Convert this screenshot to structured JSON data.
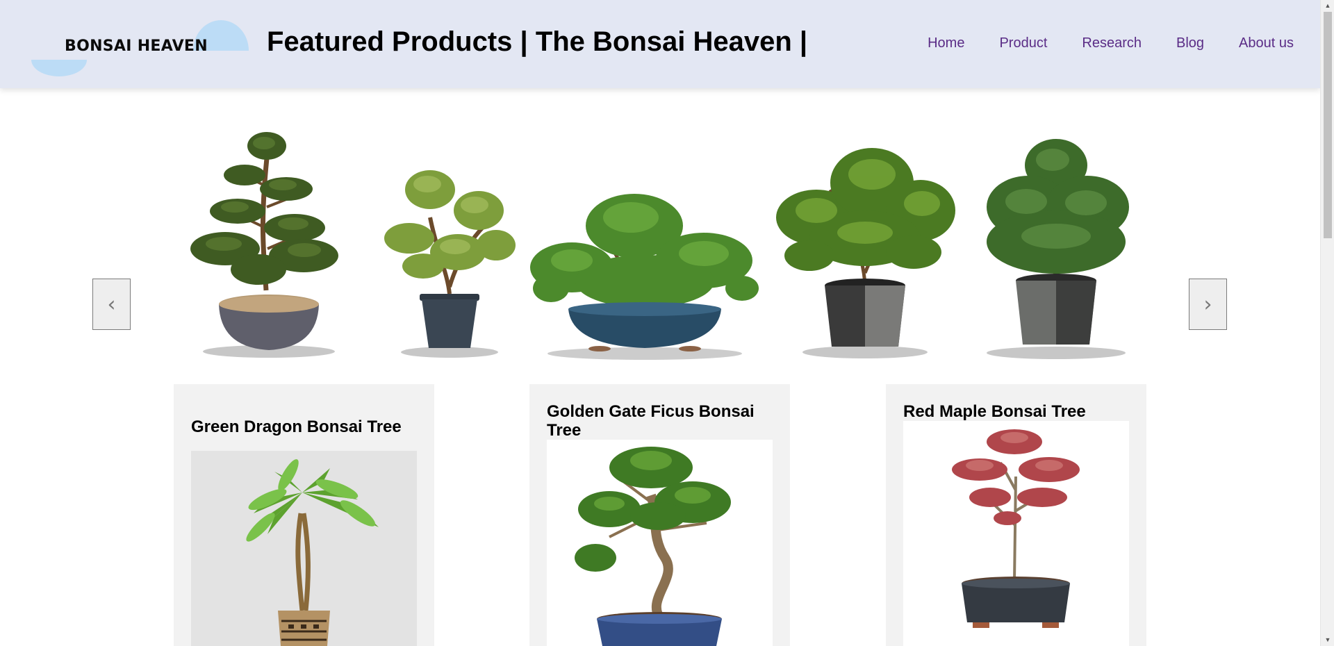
{
  "header": {
    "logo_text": "BONSAI HEAVEN",
    "title": "Featured Products | The Bonsai Heaven |",
    "nav": [
      {
        "label": "Home"
      },
      {
        "label": "Product"
      },
      {
        "label": "Research"
      },
      {
        "label": "Blog"
      },
      {
        "label": "About us"
      }
    ]
  },
  "carousel": {
    "prev_label": "‹",
    "next_label": "›"
  },
  "products": [
    {
      "name": "Green Dragon Bonsai Tree"
    },
    {
      "name": "Golden Gate Ficus Bonsai Tree"
    },
    {
      "name": "Red Maple Bonsai Tree"
    }
  ],
  "colors": {
    "header_bg": "#e3e7f3",
    "nav_link": "#5a2c86",
    "card_bg": "#f2f2f2"
  }
}
